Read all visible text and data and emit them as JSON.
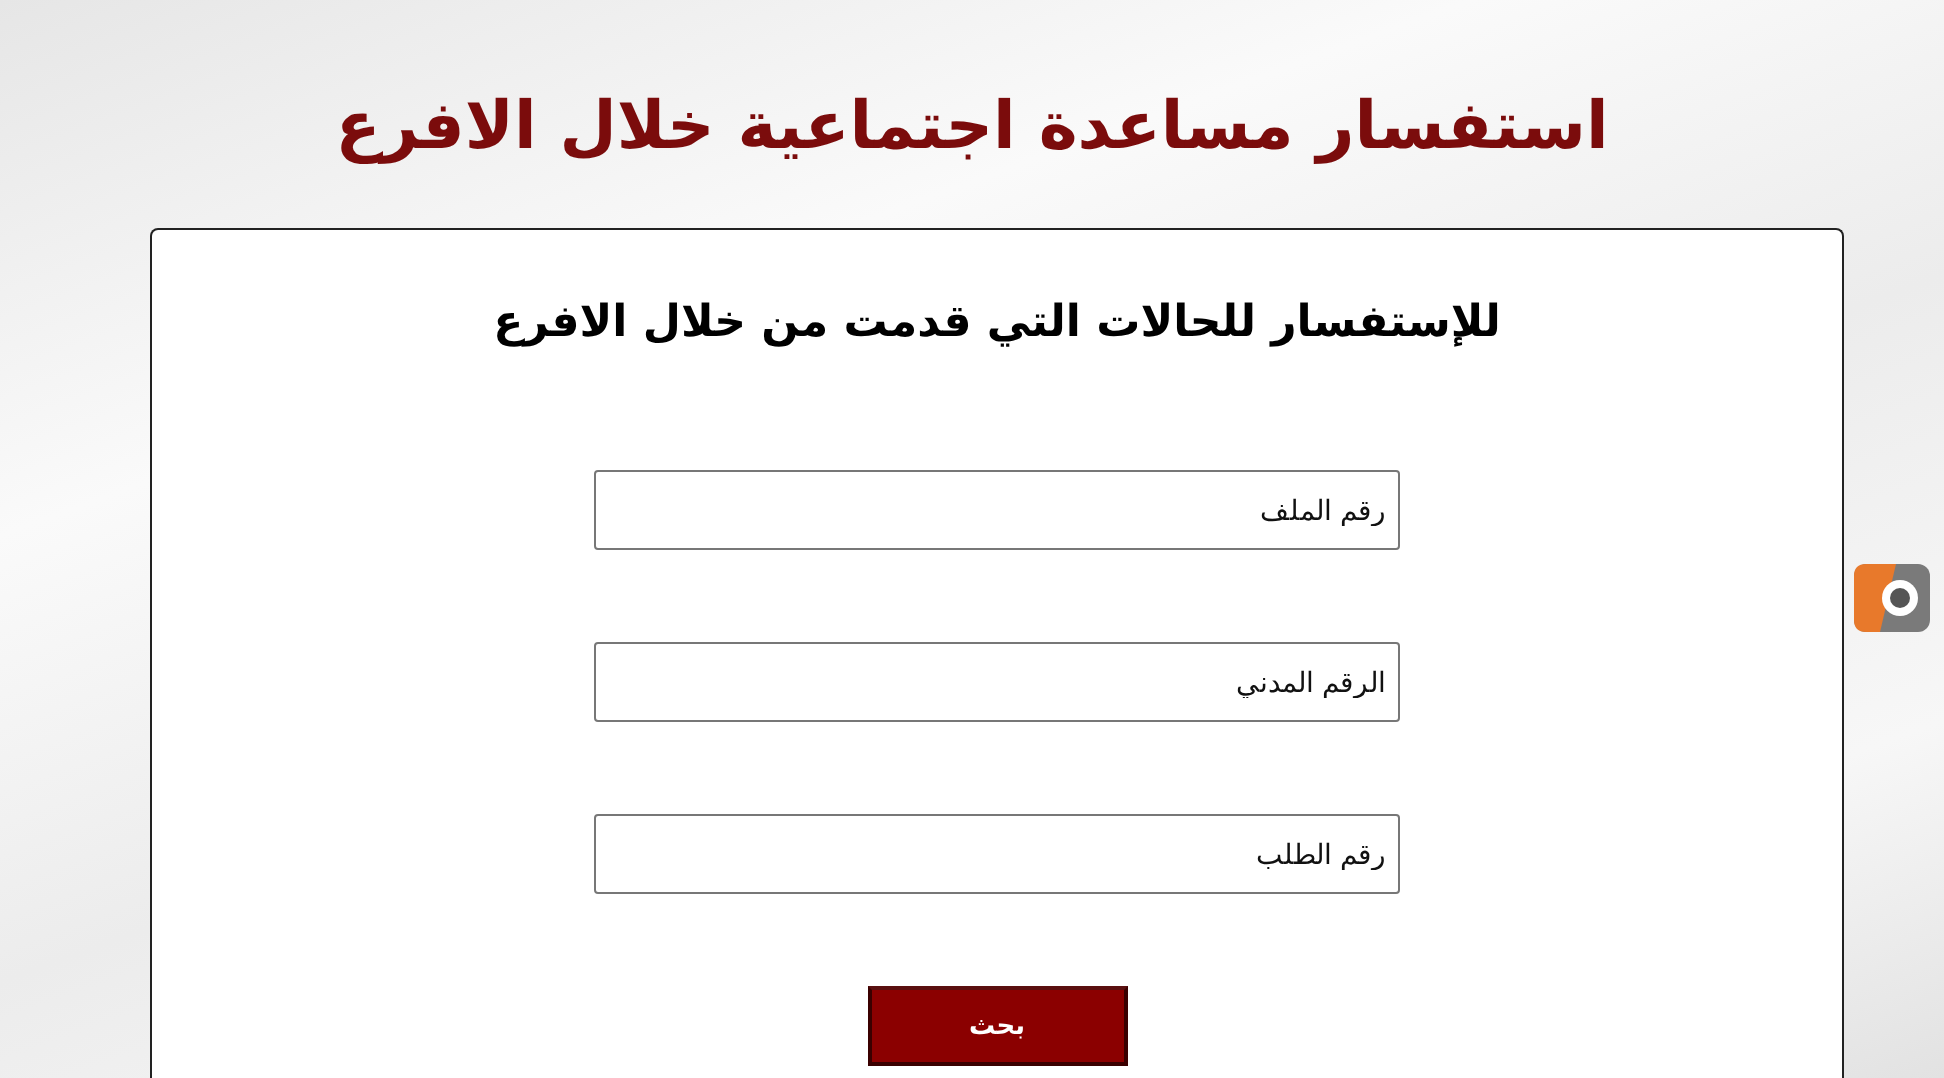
{
  "page_title": "استفسار مساعدة اجتماعية خلال الافرع",
  "form": {
    "heading": "للإستفسار للحالات التي قدمت من خلال الافرع",
    "fields": [
      {
        "placeholder": "رقم الملف"
      },
      {
        "placeholder": "الرقم المدني"
      },
      {
        "placeholder": "رقم الطلب"
      }
    ],
    "submit": "بحث"
  }
}
